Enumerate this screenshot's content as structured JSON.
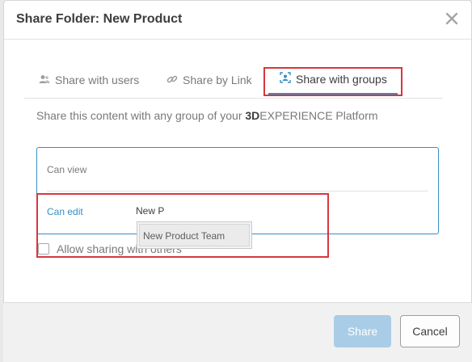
{
  "dialog": {
    "title": "Share Folder: New Product",
    "close_icon": "close-icon"
  },
  "tabs": [
    {
      "label": "Share with users",
      "icon": "users-icon",
      "active": false
    },
    {
      "label": "Share by Link",
      "icon": "link-icon",
      "active": false
    },
    {
      "label": "Share with groups",
      "icon": "group-icon",
      "active": true
    }
  ],
  "description": {
    "prefix": "Share this content with any group of your ",
    "brand_bold": "3D",
    "brand_rest": "EXPERIENCE Platform"
  },
  "permissions": {
    "can_view_label": "Can view",
    "can_edit_label": "Can edit",
    "edit_input_value": "New P"
  },
  "suggestions": [
    "New Product Team"
  ],
  "allow_sharing": {
    "label": "Allow sharing with others",
    "checked": false
  },
  "footer": {
    "share_label": "Share",
    "cancel_label": "Cancel"
  },
  "colors": {
    "accent": "#368ec4",
    "highlight": "#d9363e",
    "share_button_disabled": "#a9cde6"
  }
}
